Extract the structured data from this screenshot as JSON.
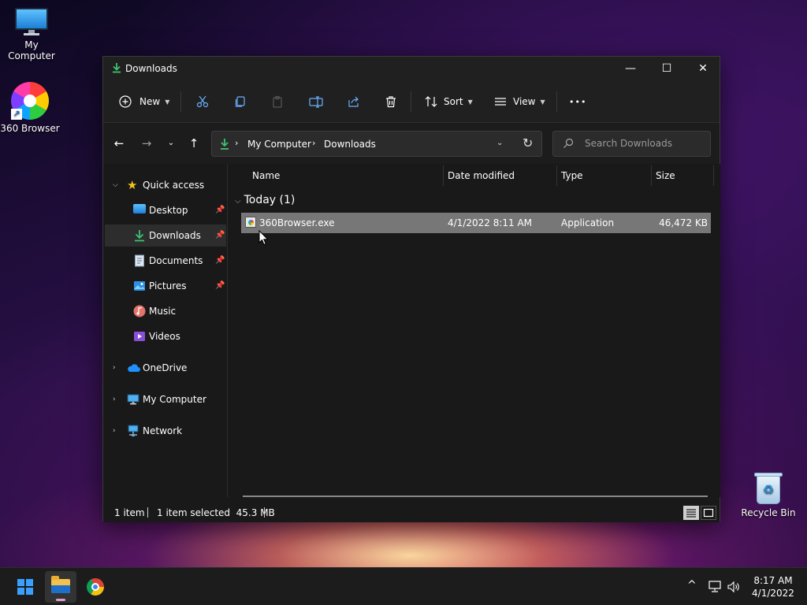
{
  "desktop": {
    "icons": [
      {
        "label": "My Computer"
      },
      {
        "label": "360 Browser"
      },
      {
        "label": "Recycle Bin"
      }
    ]
  },
  "window": {
    "title": "Downloads",
    "controls": {
      "minimize": "—",
      "maximize": "☐",
      "close": "✕"
    }
  },
  "toolbar": {
    "new_label": "New",
    "sort_label": "Sort",
    "view_label": "View",
    "more_label": "•••"
  },
  "address": {
    "crumbs": [
      "My Computer",
      "Downloads"
    ]
  },
  "search": {
    "placeholder": "Search Downloads"
  },
  "sidebar": {
    "quick_access": "Quick access",
    "items": [
      {
        "label": "Desktop",
        "icon": "desktop-icon",
        "pinned": true
      },
      {
        "label": "Downloads",
        "icon": "download-icon",
        "pinned": true,
        "selected": true
      },
      {
        "label": "Documents",
        "icon": "documents-icon",
        "pinned": true
      },
      {
        "label": "Pictures",
        "icon": "pictures-icon",
        "pinned": true
      },
      {
        "label": "Music",
        "icon": "music-icon",
        "pinned": false
      },
      {
        "label": "Videos",
        "icon": "videos-icon",
        "pinned": false
      }
    ],
    "roots": [
      "OneDrive",
      "My Computer",
      "Network"
    ]
  },
  "columns": [
    "Name",
    "Date modified",
    "Type",
    "Size"
  ],
  "group": {
    "label": "Today (1)"
  },
  "files": [
    {
      "name": "360Browser.exe",
      "date": "4/1/2022 8:11 AM",
      "type": "Application",
      "size": "46,472 KB"
    }
  ],
  "status": {
    "count": "1 item",
    "selected": "1 item selected  45.3 MB"
  },
  "taskbar": {
    "time": "8:17 AM",
    "date": "4/1/2022"
  },
  "colors": {
    "accent": "#3aa0ff",
    "download_green": "#3ec270",
    "selected_row": "#777777",
    "window_bg": "#191919"
  }
}
